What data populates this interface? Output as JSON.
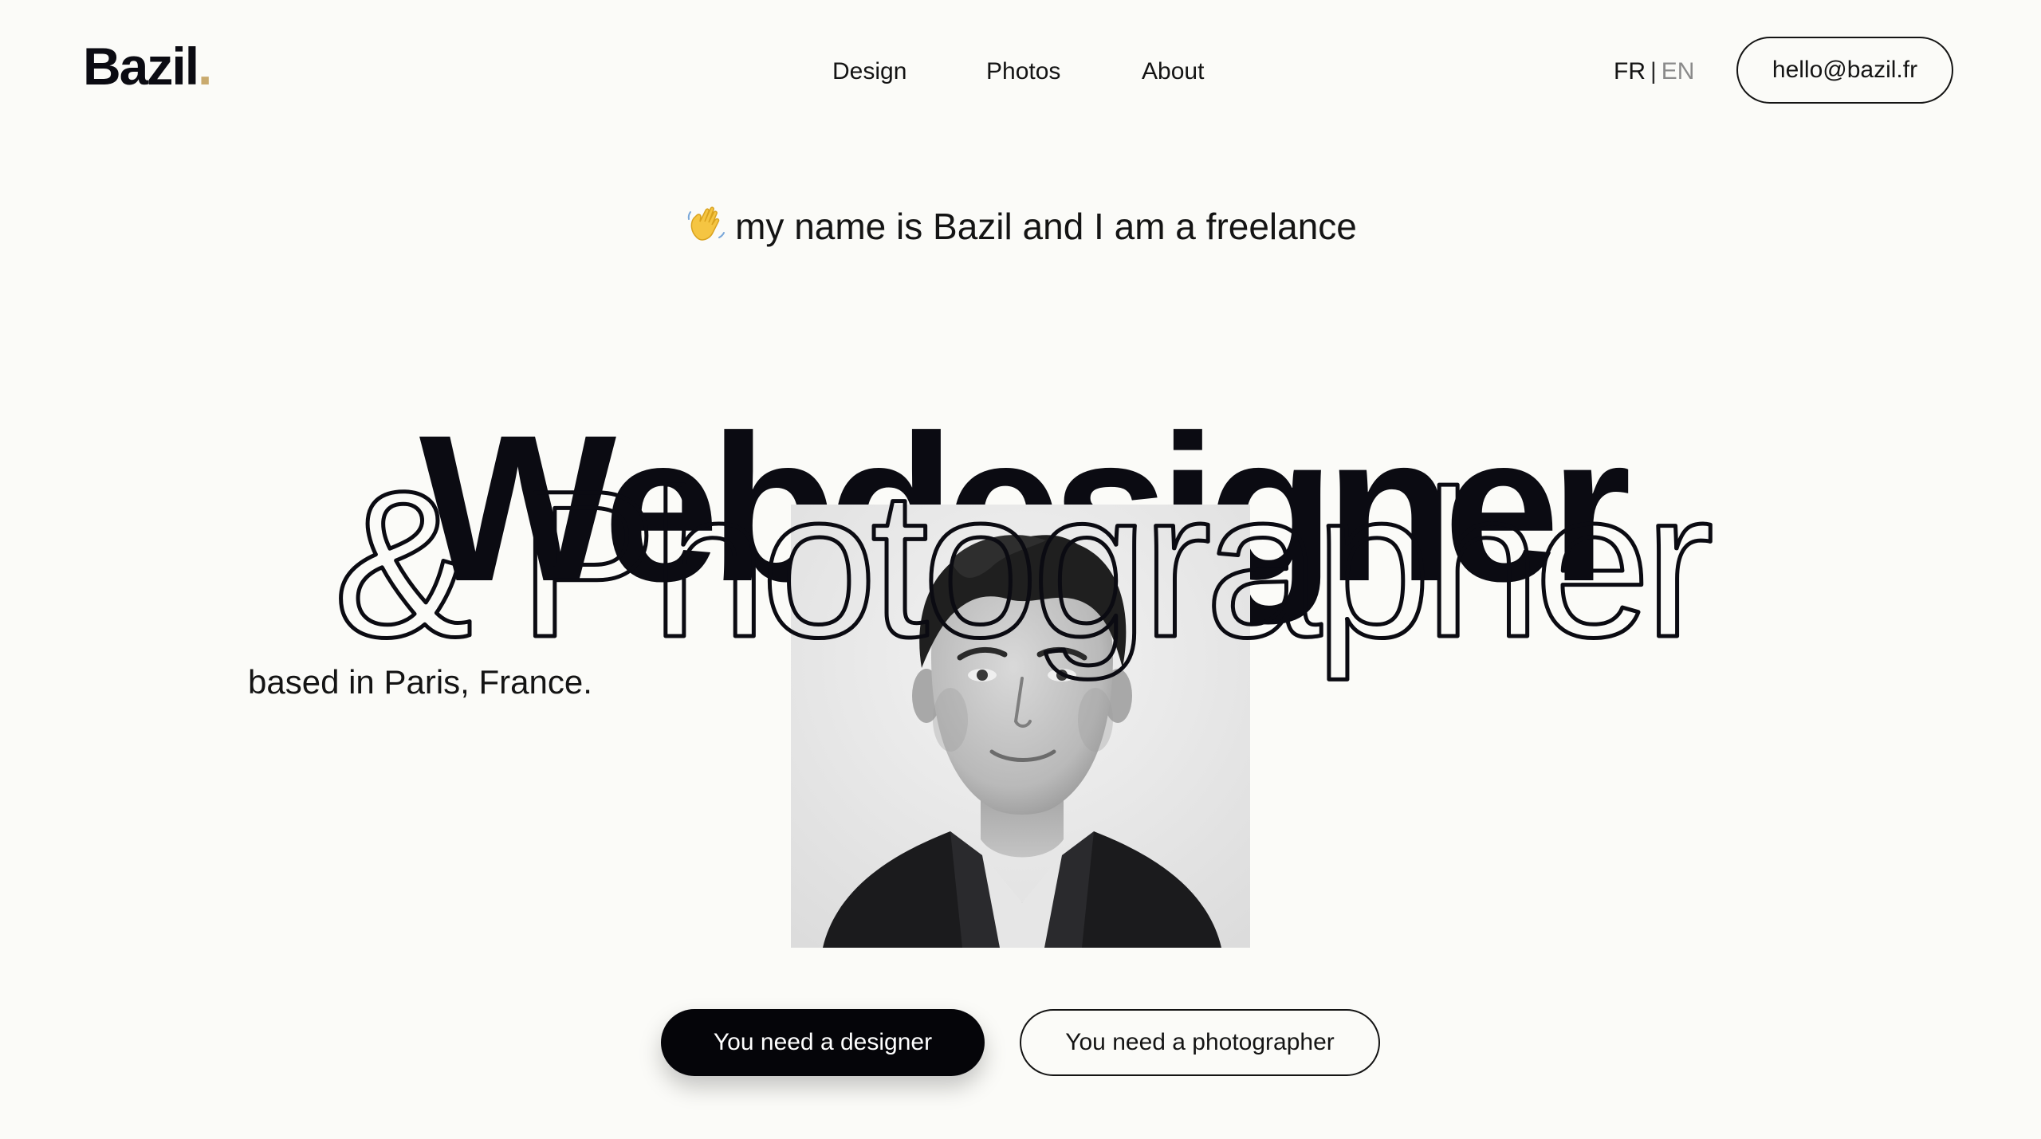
{
  "header": {
    "logo_text": "Bazil",
    "logo_dot": ".",
    "nav": [
      {
        "label": "Design"
      },
      {
        "label": "Photos"
      },
      {
        "label": "About"
      }
    ],
    "lang": {
      "active": "FR",
      "separator": "|",
      "inactive": "EN"
    },
    "email_button": "hello@bazil.fr"
  },
  "hero": {
    "intro_icon": "waving-hand-icon",
    "intro": "my name is Bazil and I am a freelance",
    "title_solid": "Webdesigner",
    "title_outline": "& Photographer",
    "location": "based in Paris, France.",
    "portrait_icon": "portrait-photo"
  },
  "cta": {
    "designer": "You need a designer",
    "photographer": "You need a photographer"
  },
  "colors": {
    "background": "#fbfbf8",
    "text": "#0b0b12",
    "accent_dot": "#c9aa6e",
    "button_dark": "#050509",
    "muted": "#8a8a8a"
  }
}
